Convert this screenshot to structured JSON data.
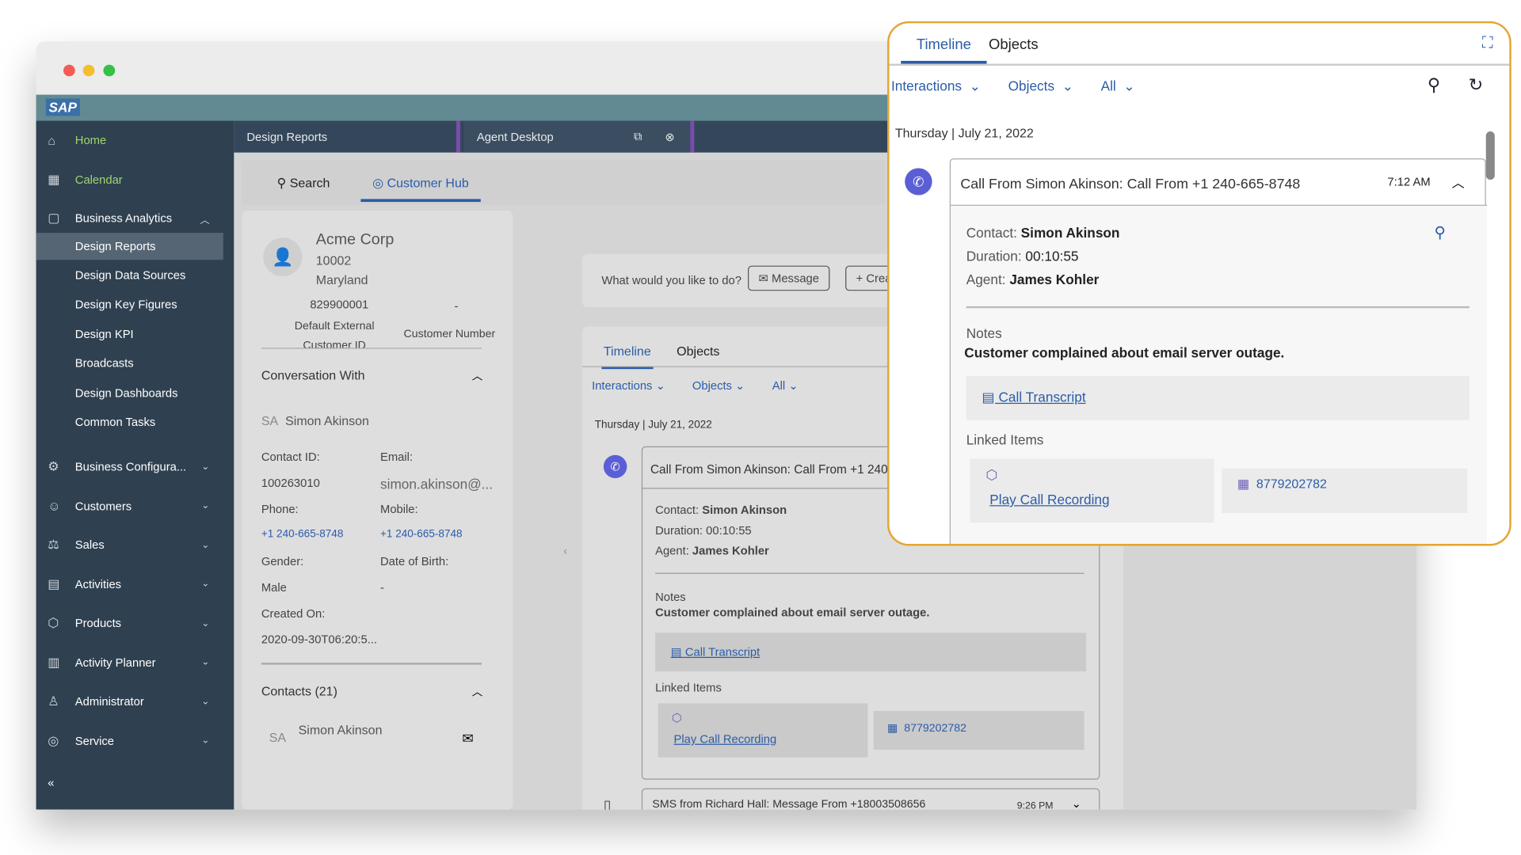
{
  "window": {
    "brand": "SAP"
  },
  "sidebar": {
    "items": [
      {
        "label": "Home",
        "icon": "home-icon",
        "active": true
      },
      {
        "label": "Calendar",
        "icon": "calendar-icon",
        "active": true
      },
      {
        "label": "Business Analytics",
        "icon": "analytics-icon",
        "expanded": true,
        "children": [
          "Design Reports",
          "Design Data Sources",
          "Design Key Figures",
          "Design KPI",
          "Broadcasts",
          "Design Dashboards",
          "Common Tasks"
        ]
      },
      {
        "label": "Business Configura...",
        "icon": "configuration-icon"
      },
      {
        "label": "Customers",
        "icon": "customers-icon"
      },
      {
        "label": "Sales",
        "icon": "sales-icon"
      },
      {
        "label": "Activities",
        "icon": "activities-icon"
      },
      {
        "label": "Products",
        "icon": "products-icon"
      },
      {
        "label": "Activity Planner",
        "icon": "planner-icon"
      },
      {
        "label": "Administrator",
        "icon": "administrator-icon"
      },
      {
        "label": "Service",
        "icon": "service-icon"
      }
    ]
  },
  "tabs": [
    "Design Reports",
    "Agent Desktop"
  ],
  "subtabs": {
    "search": "Search",
    "hub": "Customer Hub"
  },
  "customer": {
    "name": "Acme Corp",
    "zip": "10002",
    "state": "Maryland",
    "external_id": "829900001",
    "external_id_label": "Default External Customer ID",
    "customer_number": "-",
    "customer_number_label": "Customer Number"
  },
  "conversation": {
    "title": "Conversation With",
    "initials": "SA",
    "name": "Simon Akinson",
    "fields": [
      [
        "Contact ID:",
        "100263010",
        "Email:",
        "simon.akinson@..."
      ],
      [
        "Phone:",
        "+1 240-665-8748",
        "Mobile:",
        "+1 240-665-8748"
      ],
      [
        "Gender:",
        "Male",
        "Date of Birth:",
        "-"
      ],
      [
        "Created On:",
        "2020-09-30T06:20:5...",
        "",
        ""
      ]
    ]
  },
  "contacts": {
    "title": "Contacts (21)",
    "initials": "SA",
    "name": "Simon Akinson",
    "sub": "-"
  },
  "actions": {
    "prompt": "What would you like to do?",
    "message": "Message",
    "create": "Create"
  },
  "timeline": {
    "tabs": [
      "Timeline",
      "Objects"
    ],
    "filters": [
      "Interactions",
      "Objects",
      "All"
    ],
    "date": "Thursday | July 21, 2022",
    "item": {
      "title": "Call From Simon Akinson: Call From +1 240-665-8748",
      "time": "7:12 AM",
      "contact_label": "Contact:",
      "contact": "Simon Akinson",
      "duration_label": "Duration:",
      "duration": "00:10:55",
      "agent_label": "Agent:",
      "agent": "James Kohler",
      "notes_label": "Notes",
      "notes": "Customer complained about email server outage.",
      "transcript": "Call Transcript",
      "linked_label": "Linked Items",
      "recording": "Play Call Recording",
      "ticket": "8779202782"
    },
    "next": {
      "title": "SMS from Richard Hall: Message From +18003508656",
      "time": "9:26 PM"
    }
  },
  "colors": {
    "accent": "#2a5ca8",
    "sidebar": "#2f4050",
    "highlight": "#e6a530",
    "call_badge": "#5b5fd6"
  }
}
